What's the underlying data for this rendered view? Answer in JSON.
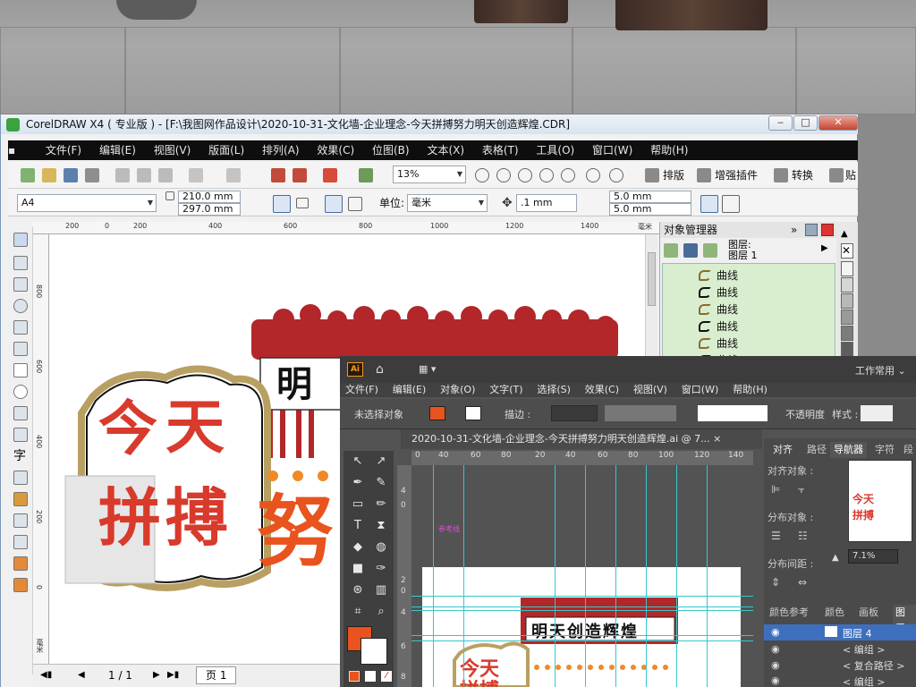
{
  "corel": {
    "title": "CorelDRAW X4 ( 专业版 ) - [F:\\我图网作品设计\\2020-10-31-文化墙-企业理念-今天拼搏努力明天创造辉煌.CDR]",
    "menu": [
      "文件(F)",
      "编辑(E)",
      "视图(V)",
      "版面(L)",
      "排列(A)",
      "效果(C)",
      "位图(B)",
      "文本(X)",
      "表格(T)",
      "工具(O)",
      "窗口(W)",
      "帮助(H)"
    ],
    "zoom": "13%",
    "toolbar_labels": {
      "layout": "排版",
      "plugin": "增强插件",
      "convert": "转换",
      "paste": "贴"
    },
    "page_size": "A4",
    "width": "210.0 mm",
    "height": "297.0 mm",
    "units_label": "单位:",
    "units_value": "毫米",
    "nudge": ".1 mm",
    "dup_x": "5.0 mm",
    "dup_y": "5.0 mm",
    "ruler_h": [
      "200",
      "0",
      "200",
      "400",
      "600",
      "800",
      "1000",
      "1200",
      "1400",
      "毫米"
    ],
    "ruler_v": [
      "800",
      "600",
      "400",
      "200",
      "0",
      "毫米"
    ],
    "page_nav": "1 / 1",
    "page_tab": "页 1",
    "colors": {
      "accent_green": "#3aa23e",
      "menu_bg": "#0e0e0e"
    }
  },
  "objmgr": {
    "title": "对象管理器",
    "layer_label": "图层:",
    "layer_name": "图层 1",
    "items": [
      "曲线",
      "曲线",
      "曲线",
      "曲线",
      "曲线",
      "曲线"
    ]
  },
  "artwork": {
    "c1": "今",
    "c2": "天",
    "c3": "拼",
    "c4": "搏",
    "c5": "明",
    "c6": "努",
    "colors": {
      "red": "#d83a2c",
      "dark_red": "#b3262a",
      "orange": "#e8531e",
      "gold": "#b8a063"
    }
  },
  "illustrator": {
    "logo": "Ai",
    "workspace": "工作常用",
    "menu": [
      "文件(F)",
      "编辑(E)",
      "对象(O)",
      "文字(T)",
      "选择(S)",
      "效果(C)",
      "视图(V)",
      "窗口(W)",
      "帮助(H)"
    ],
    "no_selection": "未选择对象",
    "stroke_label": "描边 :",
    "opacity_label": "不透明度",
    "style_label": "样式 :",
    "doc_tab": "2020-10-31-文化墙-企业理念-今天拼搏努力明天创造辉煌.ai @ 7...",
    "ruler_h": [
      "0",
      "40",
      "60",
      "80",
      "20",
      "40",
      "60",
      "80",
      "100",
      "120",
      "140"
    ],
    "ruler_v": [
      "4",
      "0",
      "2",
      "0",
      "4",
      "6",
      "8"
    ],
    "guide_label": "参考线",
    "art_top_text": "明天创造辉煌",
    "art_c1": "今天",
    "art_c2": "拼搏",
    "panel_tabs": [
      "对齐",
      "路径",
      "导航器",
      "字符",
      "段"
    ],
    "align_objects": "对齐对象 :",
    "distribute_objects": "分布对象 :",
    "distribute_spacing": "分布间距 :",
    "nav_zoom": "7.1%",
    "bottom_tabs": [
      "颜色参考",
      "颜色",
      "画板",
      "图层"
    ],
    "layers": [
      "图层 4",
      "< 编组 >",
      "< 复合路径 >",
      "< 编组 >"
    ]
  }
}
